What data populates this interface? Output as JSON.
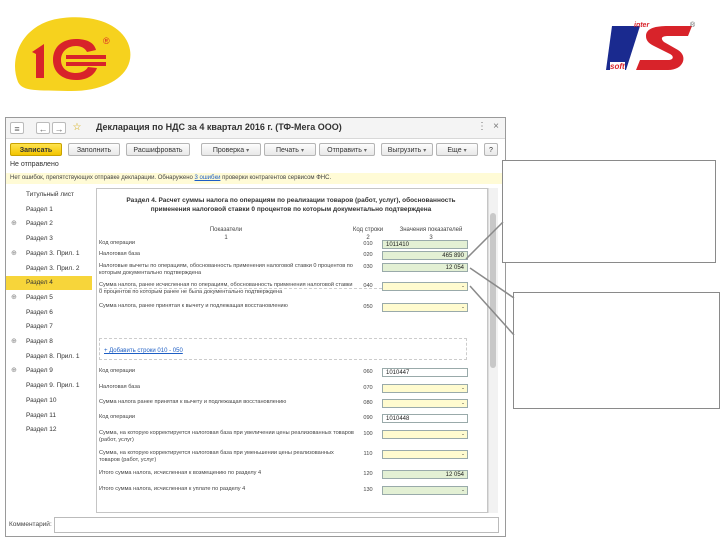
{
  "logos": {
    "left": {
      "text": "1С",
      "registered": "®"
    },
    "right": {
      "top_text": "inter",
      "main_text": "IS",
      "bottom_text": "soft",
      "registered": "®"
    }
  },
  "window": {
    "title": "Декларация по НДС за 4 квартал 2016 г. (ТФ-Мега ООО)",
    "toolbar": {
      "record": "Записать",
      "fill": "Заполнить",
      "decrypt": "Расшифровать",
      "check": "Проверка",
      "print": "Печать",
      "send": "Отправить",
      "upload": "Выгрузить",
      "more": "Еще",
      "help": "?"
    },
    "status": "Не отправлено",
    "warning": {
      "text_before": "Нет ошибок, препятствующих отправке декларации. Обнаружено ",
      "link": "3 ошибки",
      "text_after": " проверки контрагентов сервисом ФНС."
    },
    "sidebar": [
      {
        "label": "Титульный лист",
        "expand": "",
        "active": false
      },
      {
        "label": "Раздел 1",
        "expand": "",
        "active": false
      },
      {
        "label": "Раздел 2",
        "expand": "⊕",
        "active": false
      },
      {
        "label": "Раздел 3",
        "expand": "",
        "active": false
      },
      {
        "label": "Раздел 3. Прил. 1",
        "expand": "⊕",
        "active": false
      },
      {
        "label": "Раздел 3. Прил. 2",
        "expand": "",
        "active": false
      },
      {
        "label": "Раздел 4",
        "expand": "",
        "active": true
      },
      {
        "label": "Раздел 5",
        "expand": "⊕",
        "active": false
      },
      {
        "label": "Раздел 6",
        "expand": "",
        "active": false
      },
      {
        "label": "Раздел 7",
        "expand": "",
        "active": false
      },
      {
        "label": "Раздел 8",
        "expand": "⊕",
        "active": false
      },
      {
        "label": "Раздел 8. Прил. 1",
        "expand": "",
        "active": false
      },
      {
        "label": "Раздел 9",
        "expand": "⊕",
        "active": false
      },
      {
        "label": "Раздел 9. Прил. 1",
        "expand": "",
        "active": false
      },
      {
        "label": "Раздел 10",
        "expand": "",
        "active": false
      },
      {
        "label": "Раздел 11",
        "expand": "",
        "active": false
      },
      {
        "label": "Раздел 12",
        "expand": "",
        "active": false
      }
    ],
    "form": {
      "title": "Раздел 4. Расчет суммы налога по операциям по реализации товаров (работ, услуг), обоснованность применения налоговой ставки 0 процентов по которым документально подтверждена",
      "headers": {
        "indicators": "Показатели",
        "indicators_num": "1",
        "code": "Код строки",
        "code_num": "2",
        "values": "Значения показателей",
        "values_num": "3"
      },
      "add_link": "Добавить строки 010 - 050",
      "rows": [
        {
          "label": "Код операции",
          "code": "010",
          "value": "1011410",
          "style": "green",
          "align": "left"
        },
        {
          "label": "Налоговая база",
          "code": "020",
          "value": "465 890",
          "style": "green",
          "align": "right"
        },
        {
          "label": "Налоговые вычеты по операциям, обоснованность применения налоговой ставки 0 процентов по которым документально подтверждена",
          "code": "030",
          "value": "12 054",
          "style": "green",
          "align": "right"
        },
        {
          "label": "Сумма налога, ранее исчисленная по операциям, обоснованность применения налоговой ставки 0 процентов по которым ранее не была документально подтверждена",
          "code": "040",
          "value": "-",
          "style": "yellow",
          "align": "right"
        },
        {
          "label": "Сумма налога, ранее принятая к вычету и подлежащая восстановлению",
          "code": "050",
          "value": "-",
          "style": "yellow",
          "align": "right"
        },
        {
          "label": "Код операции",
          "code": "060",
          "value": "1010447",
          "style": "white",
          "align": "left"
        },
        {
          "label": "Налоговая база",
          "code": "070",
          "value": "-",
          "style": "yellow",
          "align": "right"
        },
        {
          "label": "Сумма налога ранее принятая к вычету и подлежащая восстановлению",
          "code": "080",
          "value": "-",
          "style": "yellow",
          "align": "right"
        },
        {
          "label": "Код операции",
          "code": "090",
          "value": "1010448",
          "style": "white",
          "align": "left"
        },
        {
          "label": "Сумма, на которую корректируется налоговая база при увеличении цены реализованных товаров (работ, услуг)",
          "code": "100",
          "value": "-",
          "style": "yellow",
          "align": "right"
        },
        {
          "label": "Сумма, на которую корректируется налоговая база при уменьшении цены реализованных товаров (работ, услуг)",
          "code": "110",
          "value": "-",
          "style": "yellow",
          "align": "right"
        },
        {
          "label": "Итого сумма налога, исчисленная к возмещению по разделу 4",
          "code": "120",
          "value": "12 054",
          "style": "green",
          "align": "right"
        },
        {
          "label": "Итого сумма налога, исчисленная к уплате по разделу 4",
          "code": "130",
          "value": "-",
          "style": "green",
          "align": "right"
        }
      ]
    },
    "comment_label": "Комментарий:"
  }
}
